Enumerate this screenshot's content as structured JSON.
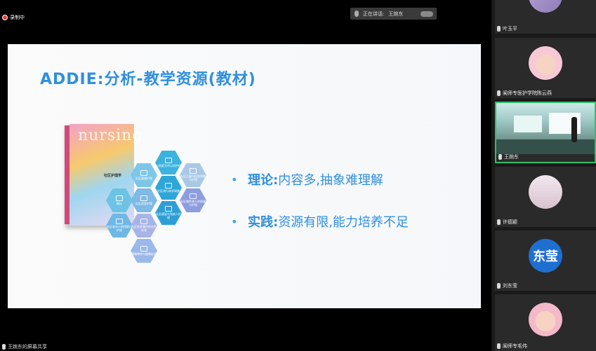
{
  "recording": {
    "label": "录制中"
  },
  "speaking_now": {
    "label": "正在讲话:",
    "name": "王婉东"
  },
  "slide": {
    "title": "ADDIE:分析-教学资源(教材)",
    "book": {
      "word": "nursing",
      "label": "社区护理学"
    },
    "hexagons": [
      "社区健康护理",
      "以家庭为中心的护理",
      "社区儿童与妇女保健与护理",
      "社区流行病学调查",
      "社区居家护理",
      "社区慢性病人的保健与护理",
      "概论",
      "社区老年人的保健与护理",
      "社区康复与残疾人护理",
      "社区突发事件的应急处理",
      "健康教育与健康促进"
    ],
    "bullets": [
      {
        "key": "理论:",
        "value": "内容多,抽象难理解"
      },
      {
        "key": "实践:",
        "value": "资源有限,能力培养不足"
      }
    ]
  },
  "participants": [
    {
      "name": "叶玉平"
    },
    {
      "name": "阆师专医护学院陈云燕"
    },
    {
      "name": "王婉东"
    },
    {
      "name": "许德颖"
    },
    {
      "name": "刘东莹",
      "avatar_text": "东莹"
    },
    {
      "name": "阆师专毛伟"
    }
  ],
  "bottom": {
    "label": "王婉东的屏幕共享"
  },
  "colors": {
    "accent": "#2f8fe0",
    "tile_bg": "#2a2a2a",
    "avatar_blue": "#1f6fd1"
  }
}
